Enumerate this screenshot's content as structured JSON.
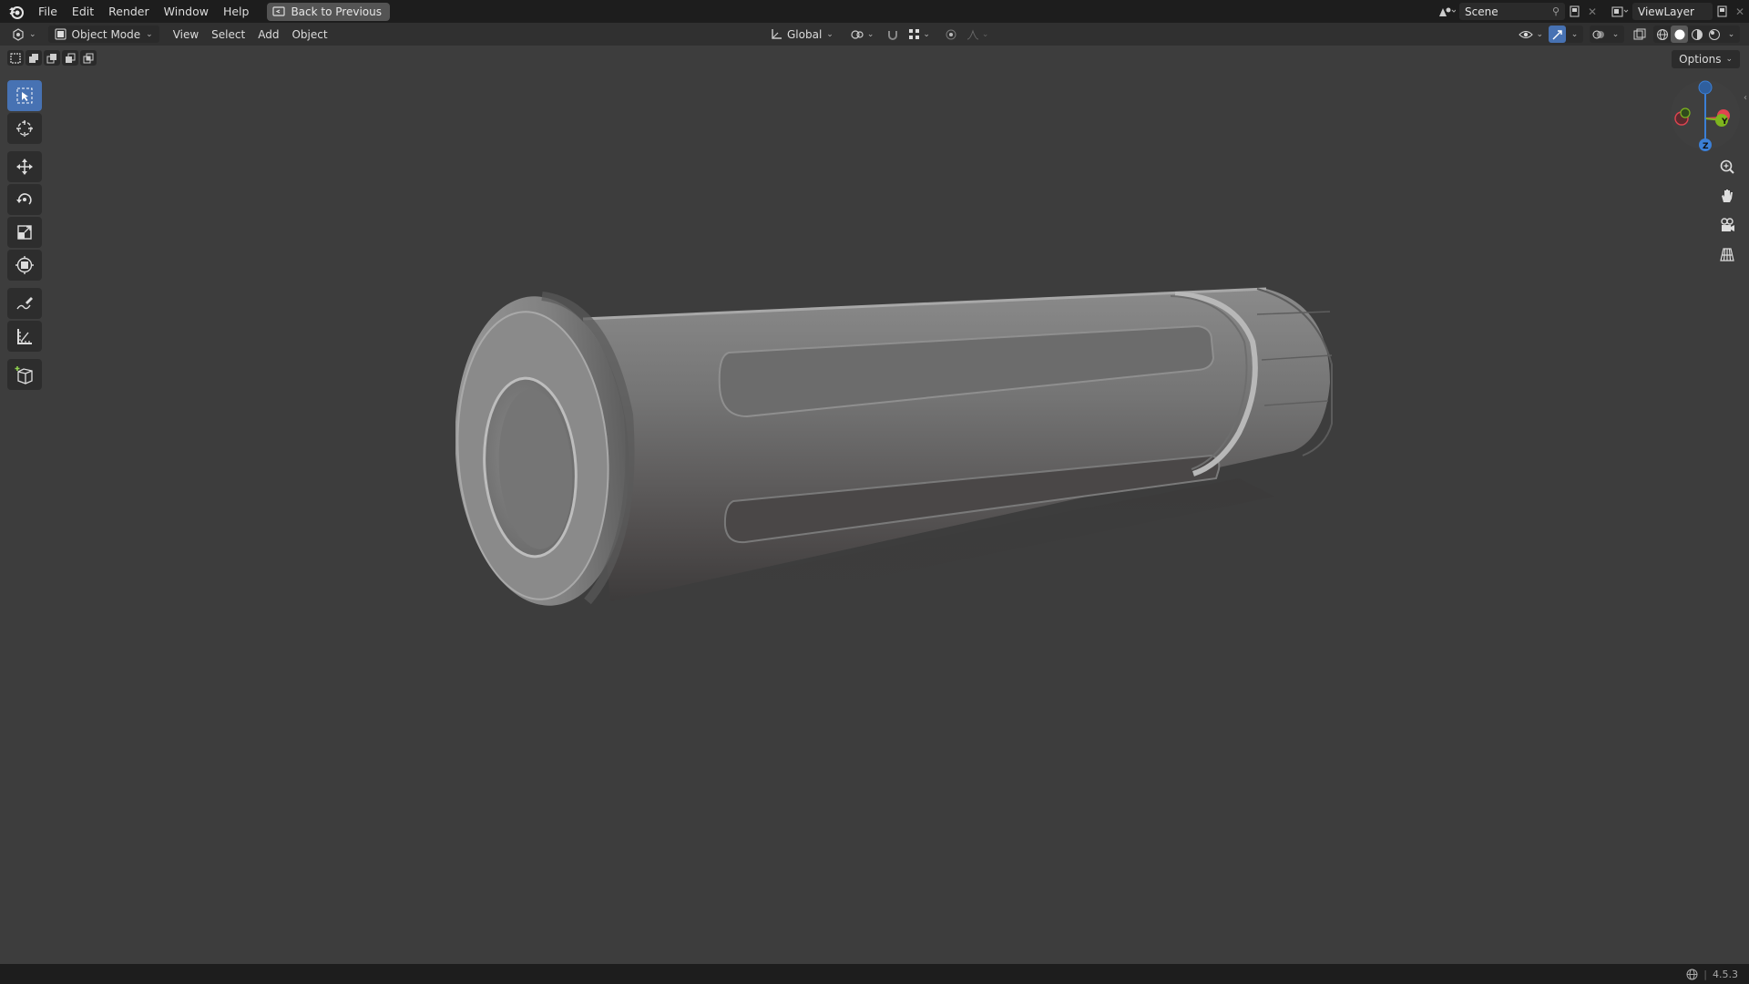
{
  "topbar": {
    "menus": [
      "File",
      "Edit",
      "Render",
      "Window",
      "Help"
    ],
    "back_label": "Back to Previous",
    "scene_name": "Scene",
    "view_layer": "ViewLayer"
  },
  "header": {
    "mode": "Object Mode",
    "menus": [
      "View",
      "Select",
      "Add",
      "Object"
    ],
    "transform_orientation": "Global"
  },
  "viewport": {
    "options_label": "Options",
    "gizmo_axes": [
      "X",
      "Y",
      "Z"
    ]
  },
  "toolbar": {
    "tools": [
      "select-box",
      "cursor",
      "move",
      "rotate",
      "scale",
      "transform",
      "annotate",
      "measure",
      "add-cube"
    ]
  },
  "status": {
    "version": "4.5.3"
  },
  "colors": {
    "accent": "#4772b3",
    "x_axis": "#e04450",
    "y_axis": "#7eb51e",
    "z_axis": "#3b7fd6"
  }
}
